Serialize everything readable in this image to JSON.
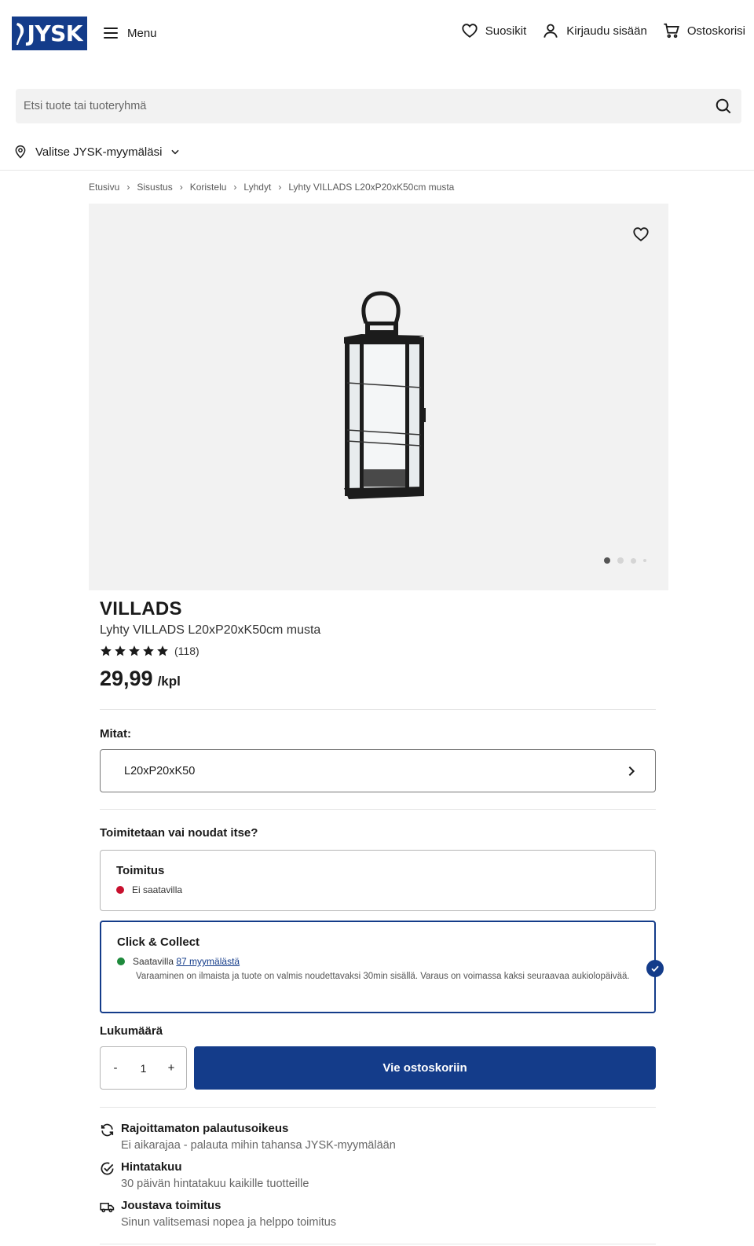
{
  "header": {
    "logo_text": "JYSK",
    "menu_label": "Menu",
    "favorites_label": "Suosikit",
    "login_label": "Kirjaudu sisään",
    "cart_label": "Ostoskorisi"
  },
  "search": {
    "placeholder": "Etsi tuote tai tuoteryhmä"
  },
  "store_select": {
    "label": "Valitse JYSK-myymäläsi"
  },
  "breadcrumb": [
    "Etusivu",
    "Sisustus",
    "Koristelu",
    "Lyhdyt",
    "Lyhty VILLADS L20xP20xK50cm musta"
  ],
  "gallery": {
    "image_count": 4,
    "active_index": 0
  },
  "product": {
    "brand": "VILLADS",
    "name": "Lyhty VILLADS L20xP20xK50cm musta",
    "rating": 5,
    "review_count": "(118)",
    "price": "29,99",
    "price_unit": "/kpl"
  },
  "size": {
    "label": "Mitat:",
    "value": "L20xP20xK50"
  },
  "delivery": {
    "heading": "Toimitetaan vai noudat itse?",
    "shipping": {
      "title": "Toimitus",
      "status": "Ei saatavilla",
      "status_color": "#c8102e"
    },
    "click_collect": {
      "title": "Click & Collect",
      "status_prefix": "Saatavilla",
      "stores_link": "87 myymälästä",
      "note": "Varaaminen on ilmaista ja tuote on valmis noudettavaksi 30min sisällä. Varaus on voimassa kaksi seuraavaa aukiolopäivää.",
      "status_color": "#1e8a3c",
      "selected": true
    }
  },
  "quantity": {
    "label": "Lukumäärä",
    "minus": "-",
    "value": "1",
    "plus": "+"
  },
  "add_to_cart_label": "Vie ostoskoriin",
  "usps": [
    {
      "icon": "refresh-icon",
      "title": "Rajoittamaton palautusoikeus",
      "text": "Ei aikarajaa - palauta mihin tahansa JYSK-myymälään"
    },
    {
      "icon": "check-circle-icon",
      "title": "Hintatakuu",
      "text": "30 päivän hintatakuu kaikille tuotteille"
    },
    {
      "icon": "truck-icon",
      "title": "Joustava toimitus",
      "text": "Sinun valitsemasi nopea ja helppo toimitus"
    }
  ],
  "colors": {
    "brand_blue": "#143c8a",
    "background_grey": "#f2f2f2"
  }
}
